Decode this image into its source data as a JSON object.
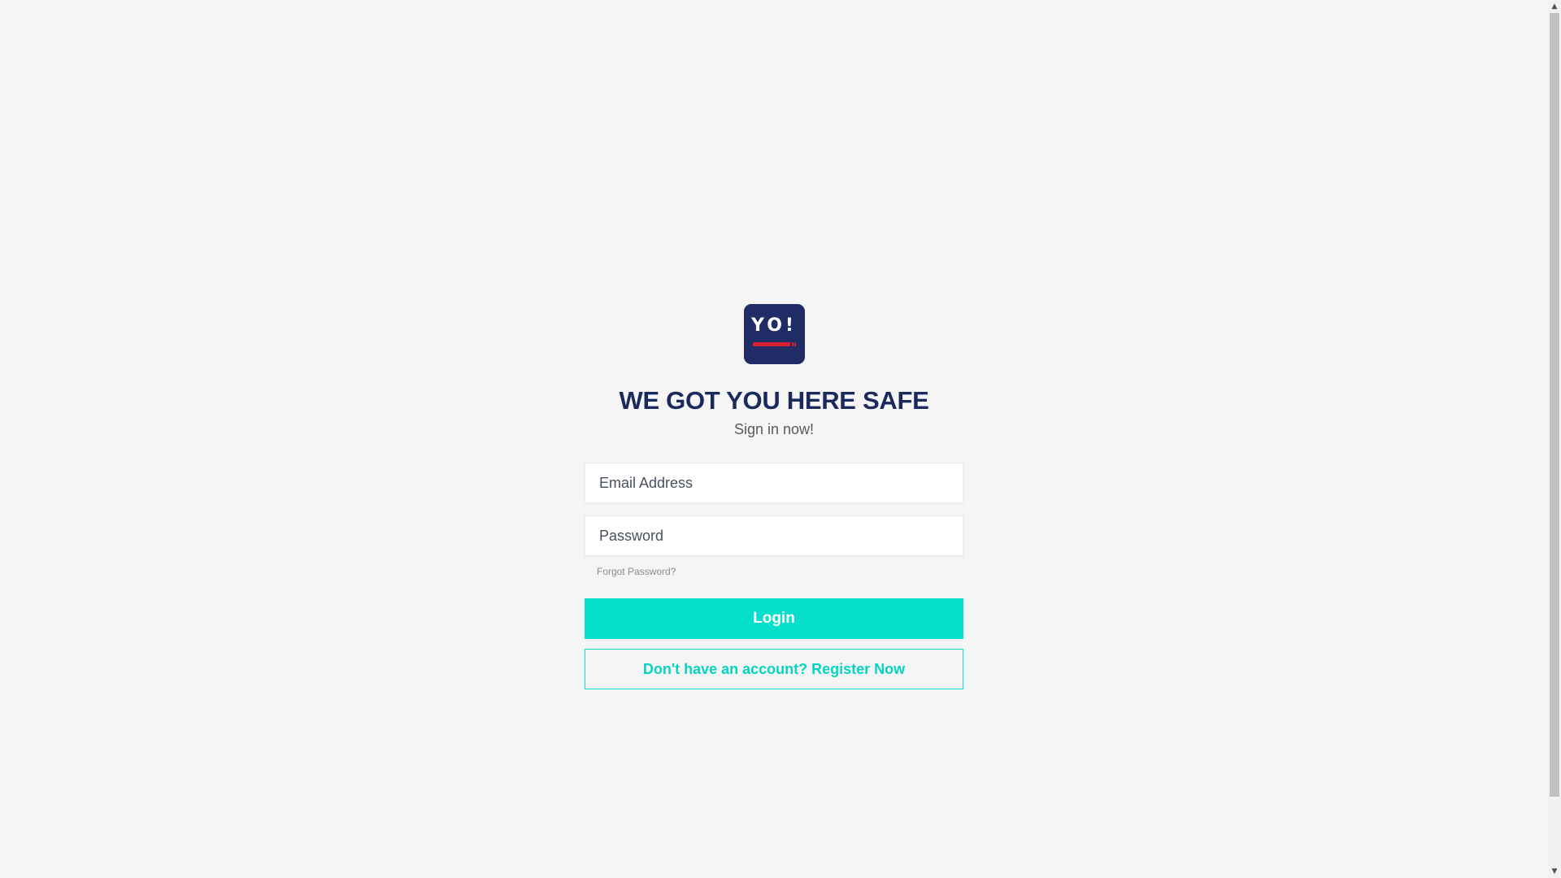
{
  "logo": {
    "text": "YO!",
    "accent_color": "#d9202e",
    "bg_color": "#1f2c66"
  },
  "headline": "WE GOT YOU HERE SAFE",
  "subtitle": "Sign in now!",
  "form": {
    "email_placeholder": "Email Address",
    "email_value": "",
    "password_placeholder": "Password",
    "password_value": "",
    "forgot_label": "Forgot Password?",
    "login_label": "Login",
    "register_label": "Don't have an account? Register Now"
  },
  "colors": {
    "brand_navy": "#1a2a5c",
    "accent_teal": "#06dfcb",
    "page_background": "#f5f5f5"
  },
  "scrollbar": {
    "up_icon": "scroll-up-arrow-icon",
    "down_icon": "scroll-down-arrow-icon"
  }
}
